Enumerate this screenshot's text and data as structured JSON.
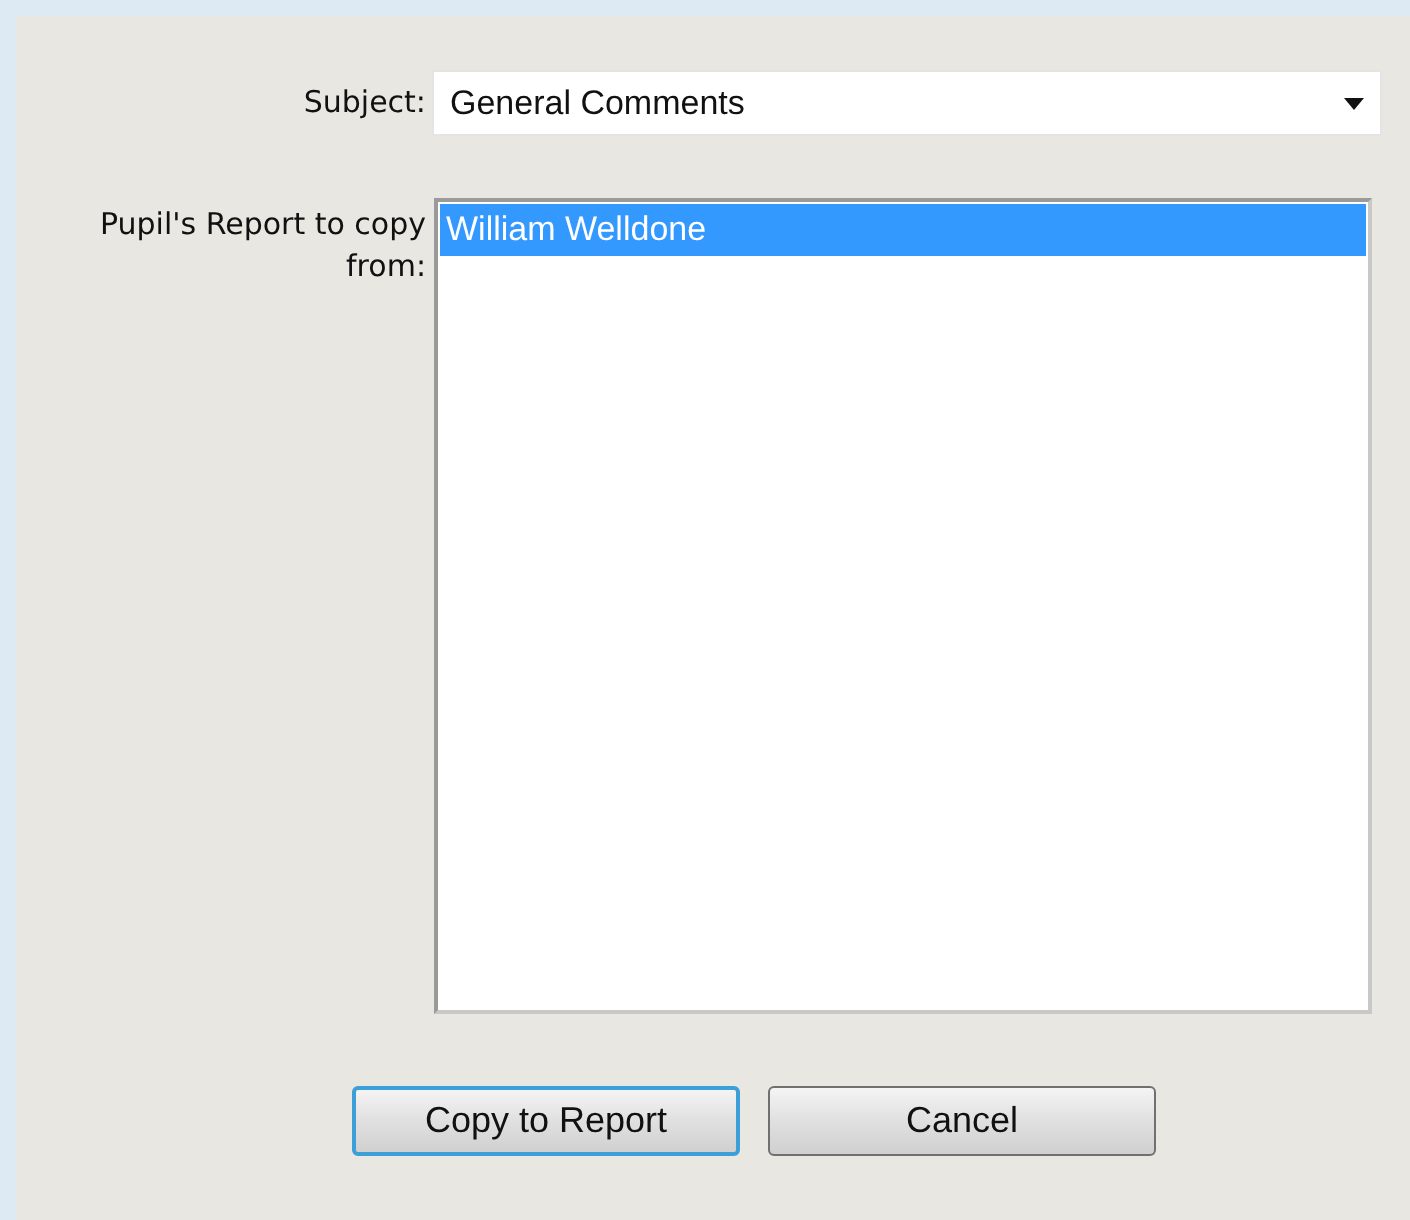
{
  "subject": {
    "label": "Subject:",
    "value": "General Comments"
  },
  "report_list": {
    "label": "Pupil's Report to copy from:",
    "items": [
      {
        "label": "William Welldone",
        "selected": true
      }
    ]
  },
  "buttons": [
    {
      "label": "Copy to Report",
      "focused": true
    },
    {
      "label": "Cancel",
      "focused": false
    }
  ]
}
